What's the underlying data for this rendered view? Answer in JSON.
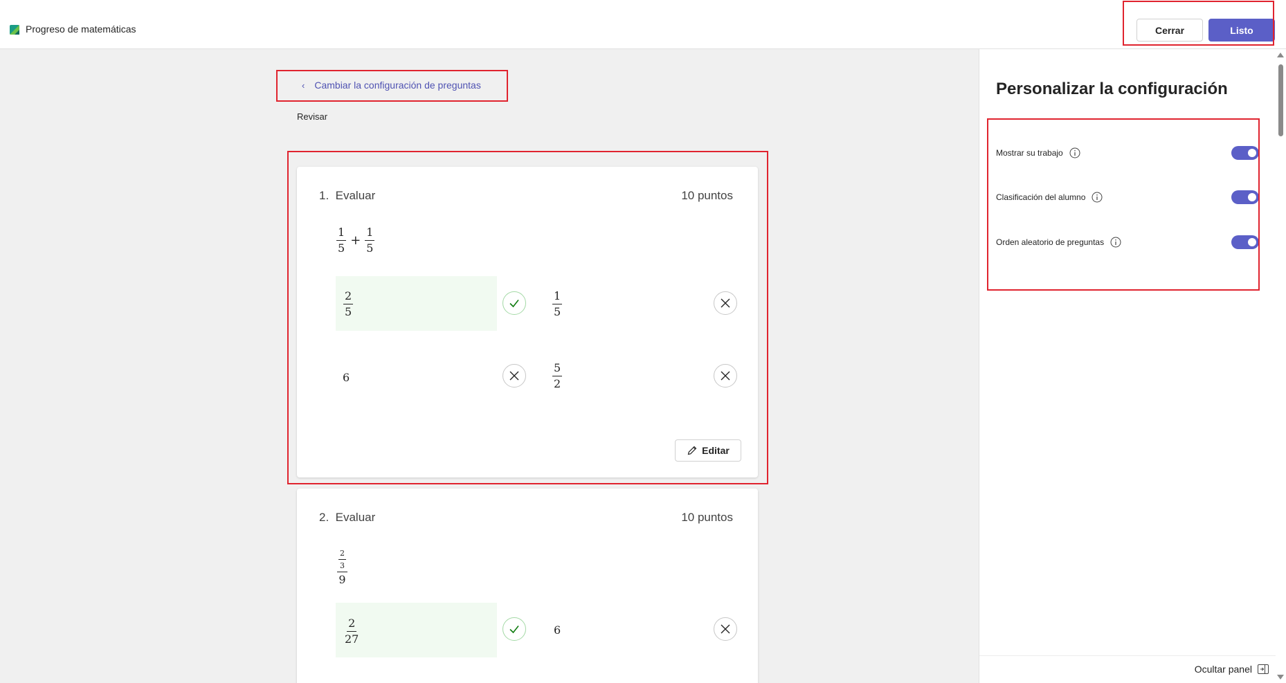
{
  "app": {
    "title": "Progreso de matemáticas",
    "logo_icon": "app-logo-icon"
  },
  "header": {
    "close_label": "Cerrar",
    "done_label": "Listo"
  },
  "main": {
    "back_link": "Cambiar la configuración de preguntas",
    "section_label": "Revisar",
    "questions": [
      {
        "number": "1.",
        "title": "Evaluar",
        "points": "10 puntos",
        "expression": {
          "a_num": "1",
          "a_den": "5",
          "op": "+",
          "b_num": "1",
          "b_den": "5"
        },
        "answers": [
          {
            "num": "2",
            "den": "5",
            "status": "correct"
          },
          {
            "num": "1",
            "den": "5",
            "status": "incorrect"
          },
          {
            "value": "6",
            "status": "incorrect"
          },
          {
            "num": "5",
            "den": "2",
            "status": "incorrect"
          }
        ],
        "edit_label": "Editar"
      },
      {
        "number": "2.",
        "title": "Evaluar",
        "points": "10 puntos",
        "expression": {
          "inner_num": "2",
          "inner_den": "3",
          "den": "9"
        },
        "answers": [
          {
            "num": "2",
            "den": "27",
            "status": "correct"
          },
          {
            "value": "6",
            "status": "incorrect"
          }
        ]
      }
    ]
  },
  "panel": {
    "title": "Personalizar la configuración",
    "settings": [
      {
        "label": "Mostrar su trabajo",
        "enabled": true
      },
      {
        "label": "Clasificación del alumno",
        "enabled": true
      },
      {
        "label": "Orden aleatorio de preguntas",
        "enabled": true
      }
    ],
    "hide_panel_label": "Ocultar panel"
  },
  "colors": {
    "accent": "#5b5fc7",
    "link": "#4f52b2",
    "correct": "#107c10",
    "highlight": "#e0232e"
  }
}
